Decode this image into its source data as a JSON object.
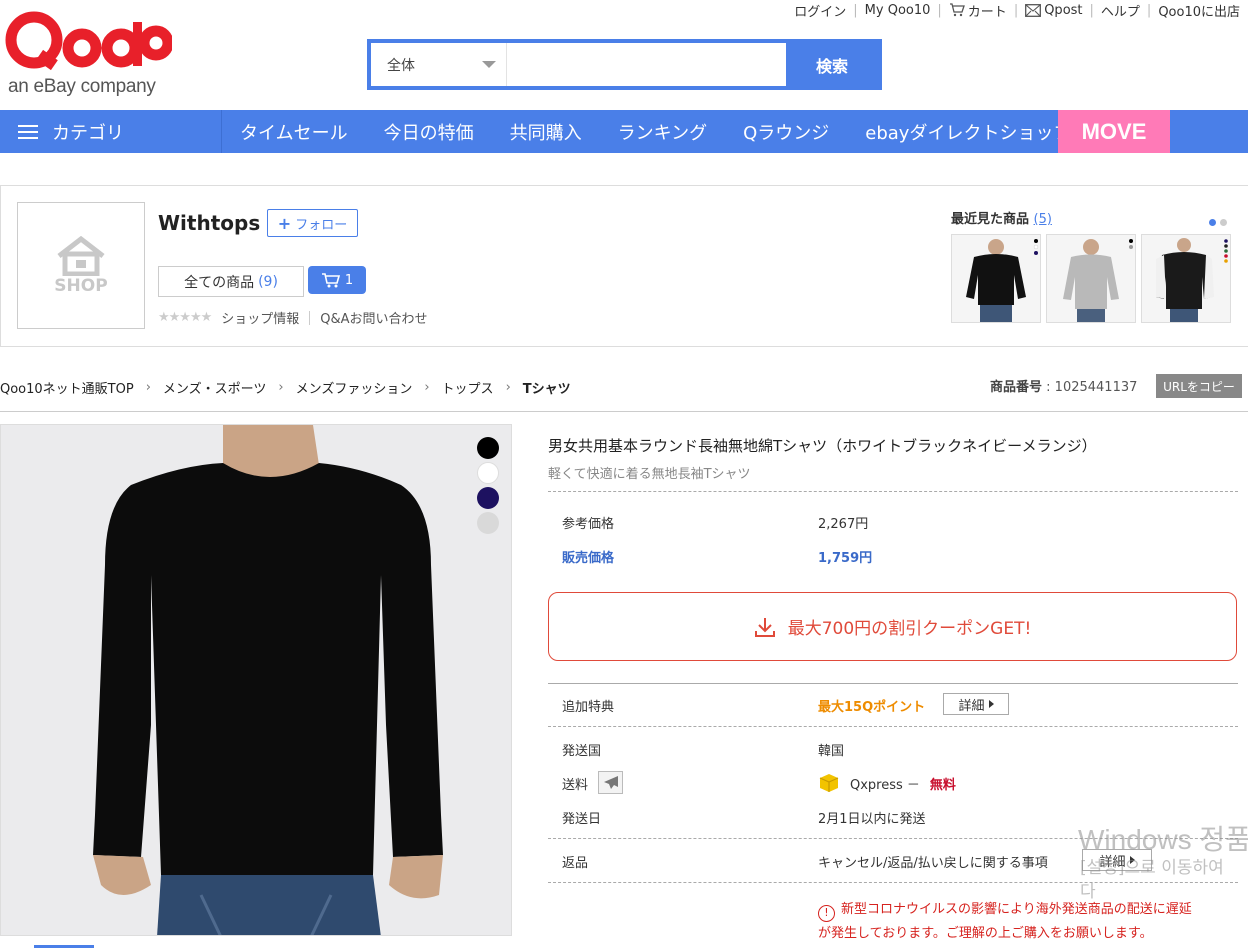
{
  "util_links": [
    {
      "label": "ログイン",
      "icon": ""
    },
    {
      "label": "My Qoo10",
      "icon": ""
    },
    {
      "label": "カート",
      "icon": "cart-icon"
    },
    {
      "label": "Qpost",
      "icon": "mail-icon"
    },
    {
      "label": "ヘルプ",
      "icon": ""
    },
    {
      "label": "Qoo10に出店",
      "icon": ""
    }
  ],
  "logo": {
    "brand": "Qoo10",
    "sub": "an eBay company",
    "color": "#e8202a"
  },
  "search": {
    "category": "全体",
    "button": "検索",
    "value": "",
    "accent": "#4a7fe8"
  },
  "nav": {
    "category_label": "カテゴリ",
    "items": [
      "タイムセール",
      "今日の特価",
      "共同購入",
      "ランキング",
      "Qラウンジ",
      "ebayダイレクトショップ"
    ],
    "move": "MOVE",
    "move_color": "#ff7ab7"
  },
  "shop": {
    "logo_text": "SHOP",
    "name": "Withtops",
    "follow": "フォロー",
    "all_items": "全ての商品",
    "all_count": "(9)",
    "cart_count": "1",
    "shop_info": "ショップ情報",
    "qa": "Q&Aお問い合わせ",
    "recent_label": "最近見た商品",
    "recent_count": "(5)"
  },
  "breadcrumb": [
    "Qoo10ネット通販TOP",
    "メンズ・スポーツ",
    "メンズファッション",
    "トップス",
    "Tシャツ"
  ],
  "product_no": {
    "label": "商品番号",
    "value": ": 1025441137",
    "copy": "URLをコピー"
  },
  "product": {
    "title": "男女共用基本ラウンド長袖無地綿Tシャツ（ホワイトブラックネイビーメランジ）",
    "subtitle": "軽くて快適に着る無地長袖Tシャツ",
    "ref_price_label": "参考価格",
    "ref_price": "2,267円",
    "sale_price_label": "販売価格",
    "sale_price": "1,759円",
    "coupon": "最大700円の割引クーポンGET!",
    "bonus_label": "追加特典",
    "bonus_value": "最大15Qポイント",
    "detail": "詳細",
    "ship_country_label": "発送国",
    "ship_country": "韓国",
    "shipping_label": "送料",
    "shipping_method": "Qxpress －",
    "shipping_fee": "無料",
    "ship_date_label": "発送日",
    "ship_date": "2月1日以内に発送",
    "return_label": "返品",
    "return_value": "キャンセル/返品/払い戻しに関する事項",
    "return_detail": "詳細",
    "notice_line1": "新型コロナウイルスの影響により海外発送商品の配送に遅延",
    "notice_line2": "が発生しております。ご理解の上ご購入をお願いします。",
    "swatches": [
      "#000000",
      "#ffffff",
      "#1d1160",
      "#d9d9d9"
    ]
  },
  "watermark": {
    "line1": "Windows 정품",
    "line2": "[설정]으로 이동하여",
    "line3": "다"
  }
}
